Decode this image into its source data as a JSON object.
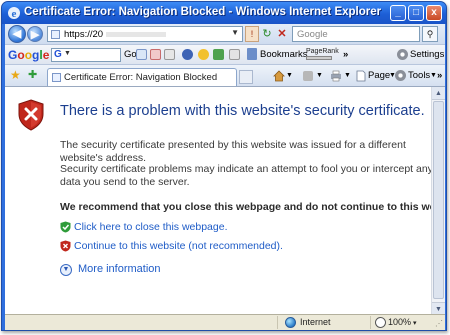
{
  "window": {
    "title": "Certificate Error: Navigation Blocked - Windows Internet Explorer",
    "minimize": "_",
    "maximize": "□",
    "close": "x"
  },
  "addressbar": {
    "url": "https://20",
    "search_placeholder": "Google"
  },
  "google_toolbar": {
    "logo_letters": [
      "G",
      "o",
      "o",
      "g",
      "l",
      "e"
    ],
    "search_glyph": "G",
    "go_label": "Go",
    "bookmarks_label": "Bookmarks",
    "pagerank_label": "PageRank",
    "more": "»",
    "settings_label": "Settings"
  },
  "tab": {
    "label": "Certificate Error: Navigation Blocked"
  },
  "command_bar": {
    "page_label": "Page",
    "tools_label": "Tools",
    "more": "»"
  },
  "content": {
    "heading": "There is a problem with this website's security certificate.",
    "para1": "The security certificate presented by this website was issued for a different website's address.",
    "para2": "Security certificate problems may indicate an attempt to fool you or intercept any data you send to the server.",
    "recommend": "We recommend that you close this webpage and do not continue to this website.",
    "close_link": "Click here to close this webpage.",
    "continue_link": "Continue to this website (not recommended).",
    "more_info": "More information"
  },
  "statusbar": {
    "zone": "Internet",
    "zoom": "100%",
    "zoom_dd": "▾"
  },
  "colors": {
    "title_blue": "#1d5fd6",
    "heading_blue": "#1c3f8f",
    "link_blue": "#1f5cc7",
    "error_red": "#c0271c",
    "safe_green": "#2f9c3a"
  },
  "icons": [
    "ie-icon",
    "back-icon",
    "forward-icon",
    "page-icon",
    "certificate-error-icon",
    "refresh-icon",
    "stop-icon",
    "search-icon",
    "favorites-star-icon",
    "add-favorites-icon",
    "home-icon",
    "feeds-icon",
    "print-icon",
    "gear-icon",
    "shield-error-icon",
    "green-shield-icon",
    "red-shield-icon",
    "chevron-down-circle-icon",
    "globe-icon",
    "zoom-icon"
  ]
}
